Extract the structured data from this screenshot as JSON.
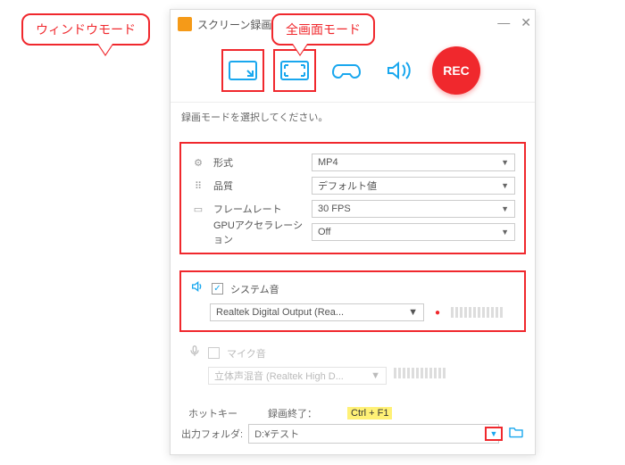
{
  "callouts": {
    "window_mode": "ウィンドウモード",
    "fullscreen_mode": "全画面モード"
  },
  "window": {
    "title": "スクリーン録画",
    "rec_label": "REC",
    "hint": "録画モードを選択してください。"
  },
  "settings": {
    "format": {
      "label": "形式",
      "value": "MP4"
    },
    "quality": {
      "label": "品質",
      "value": "デフォルト値"
    },
    "framerate": {
      "label": "フレームレート",
      "value": "30 FPS"
    },
    "gpu": {
      "label": "GPUアクセラレーション",
      "value": "Off"
    }
  },
  "audio": {
    "system_label": "システム音",
    "system_device": "Realtek Digital Output (Rea...",
    "mic_label": "マイク音",
    "mic_device": "立体声混音 (Realtek High D..."
  },
  "hotkey": {
    "label": "ホットキー",
    "action": "録画終了：",
    "combo": "Ctrl + F1"
  },
  "output": {
    "label": "出力フォルダ:",
    "path": "D:¥テスト"
  }
}
